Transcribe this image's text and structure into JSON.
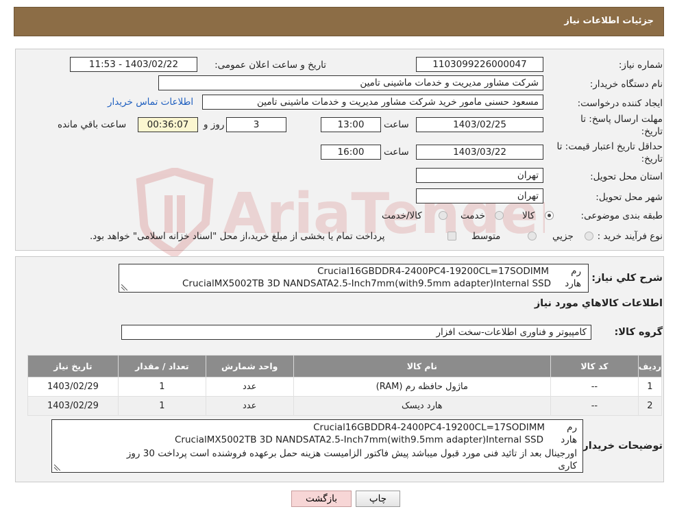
{
  "header": {
    "title": "جزئیات اطلاعات نیاز"
  },
  "form": {
    "need_number": {
      "label": "شماره نیاز:",
      "value": "1103099226000047"
    },
    "announce": {
      "label": "تاریخ و ساعت اعلان عمومی:",
      "value": "1403/02/22 - 11:53"
    },
    "buyer_org": {
      "label": "نام دستگاه خریدار:",
      "value": "شرکت مشاور مدیریت و خدمات ماشینی تامین"
    },
    "requester": {
      "label": "ایجاد کننده درخواست:",
      "value": "مسعود حسنی مامور خرید شرکت مشاور مدیریت و خدمات ماشینی تامین",
      "contact_link": "اطلاعات تماس خریدار"
    },
    "send_deadline": {
      "label_line1": "مهلت ارسال پاسخ: تا",
      "label_line2": "تاریخ:",
      "date": "1403/02/25",
      "time_label": "ساعت",
      "time": "13:00",
      "days": "3",
      "days_label": "روز و",
      "remaining": "00:36:07",
      "remaining_label": "ساعت باقي مانده"
    },
    "price_validity": {
      "label_line1": "حداقل تاریخ اعتبار قیمت: تا",
      "label_line2": "تاریخ:",
      "date": "1403/03/22",
      "time_label": "ساعت",
      "time": "16:00"
    },
    "province": {
      "label": "استان محل تحویل:",
      "value": "تهران"
    },
    "city": {
      "label": "شهر محل تحویل:",
      "value": "تهران"
    },
    "category": {
      "label": "طبقه بندی موضوعی:",
      "options": [
        "کالا",
        "خدمت",
        "کالا/خدمت"
      ]
    },
    "process": {
      "label": "نوع فرآیند خرید :",
      "options": [
        "جزیي",
        "متوسط"
      ],
      "note": "پرداخت تمام یا بخشی از مبلغ خرید،از محل \"اسناد خزانه اسلامی\" خواهد بود."
    }
  },
  "description": {
    "label": "شرح کلي نياز:",
    "line1_prefix": "رم",
    "line1_text": "Crucial16GBDDR4-2400PC4-19200CL=17SODIMM",
    "line2_prefix": "هارد",
    "line2_text": "CrucialMX5002TB 3D NANDSATA2.5-Inch7mm(with9.5mm adapter)Internal SSD"
  },
  "goods_info": {
    "title": "اطلاعات کالاهاي مورد نياز"
  },
  "goods_group": {
    "label": "گروه کالا:",
    "value": "کامپیوتر و فناوری اطلاعات-سخت افزار"
  },
  "table": {
    "headers": [
      "رديف",
      "کد کالا",
      "نام کالا",
      "واحد شمارش",
      "تعداد / مقدار",
      "تاريخ نياز"
    ],
    "rows": [
      [
        "1",
        "--",
        "ماژول حافظه رم (RAM)",
        "عدد",
        "1",
        "1403/02/29"
      ],
      [
        "2",
        "--",
        "هارد دیسک",
        "عدد",
        "1",
        "1403/02/29"
      ]
    ]
  },
  "buyer_notes": {
    "label": "توضیحات خریدار:",
    "line1_prefix": "رم",
    "line1_text": "Crucial16GBDDR4-2400PC4-19200CL=17SODIMM",
    "line2_prefix": "هارد",
    "line2_text": "CrucialMX5002TB 3D NANDSATA2.5-Inch7mm(with9.5mm adapter)Internal SSD",
    "line3": "اورجینال بعد از تائید فنی مورد قبول میباشد پیش فاکتور الزامیست  هزینه حمل برعهده فروشنده است  پرداخت  30 روز",
    "line4": "کاری"
  },
  "buttons": {
    "print": "چاپ",
    "back": "بازگشت"
  },
  "watermark": {
    "text": "AriaTender.neT"
  },
  "colors": {
    "header_bg": "#8c6d46",
    "table_header_bg": "#8c8c8c",
    "link": "#1f5fbf",
    "back_button_bg": "#f7d6d6"
  }
}
